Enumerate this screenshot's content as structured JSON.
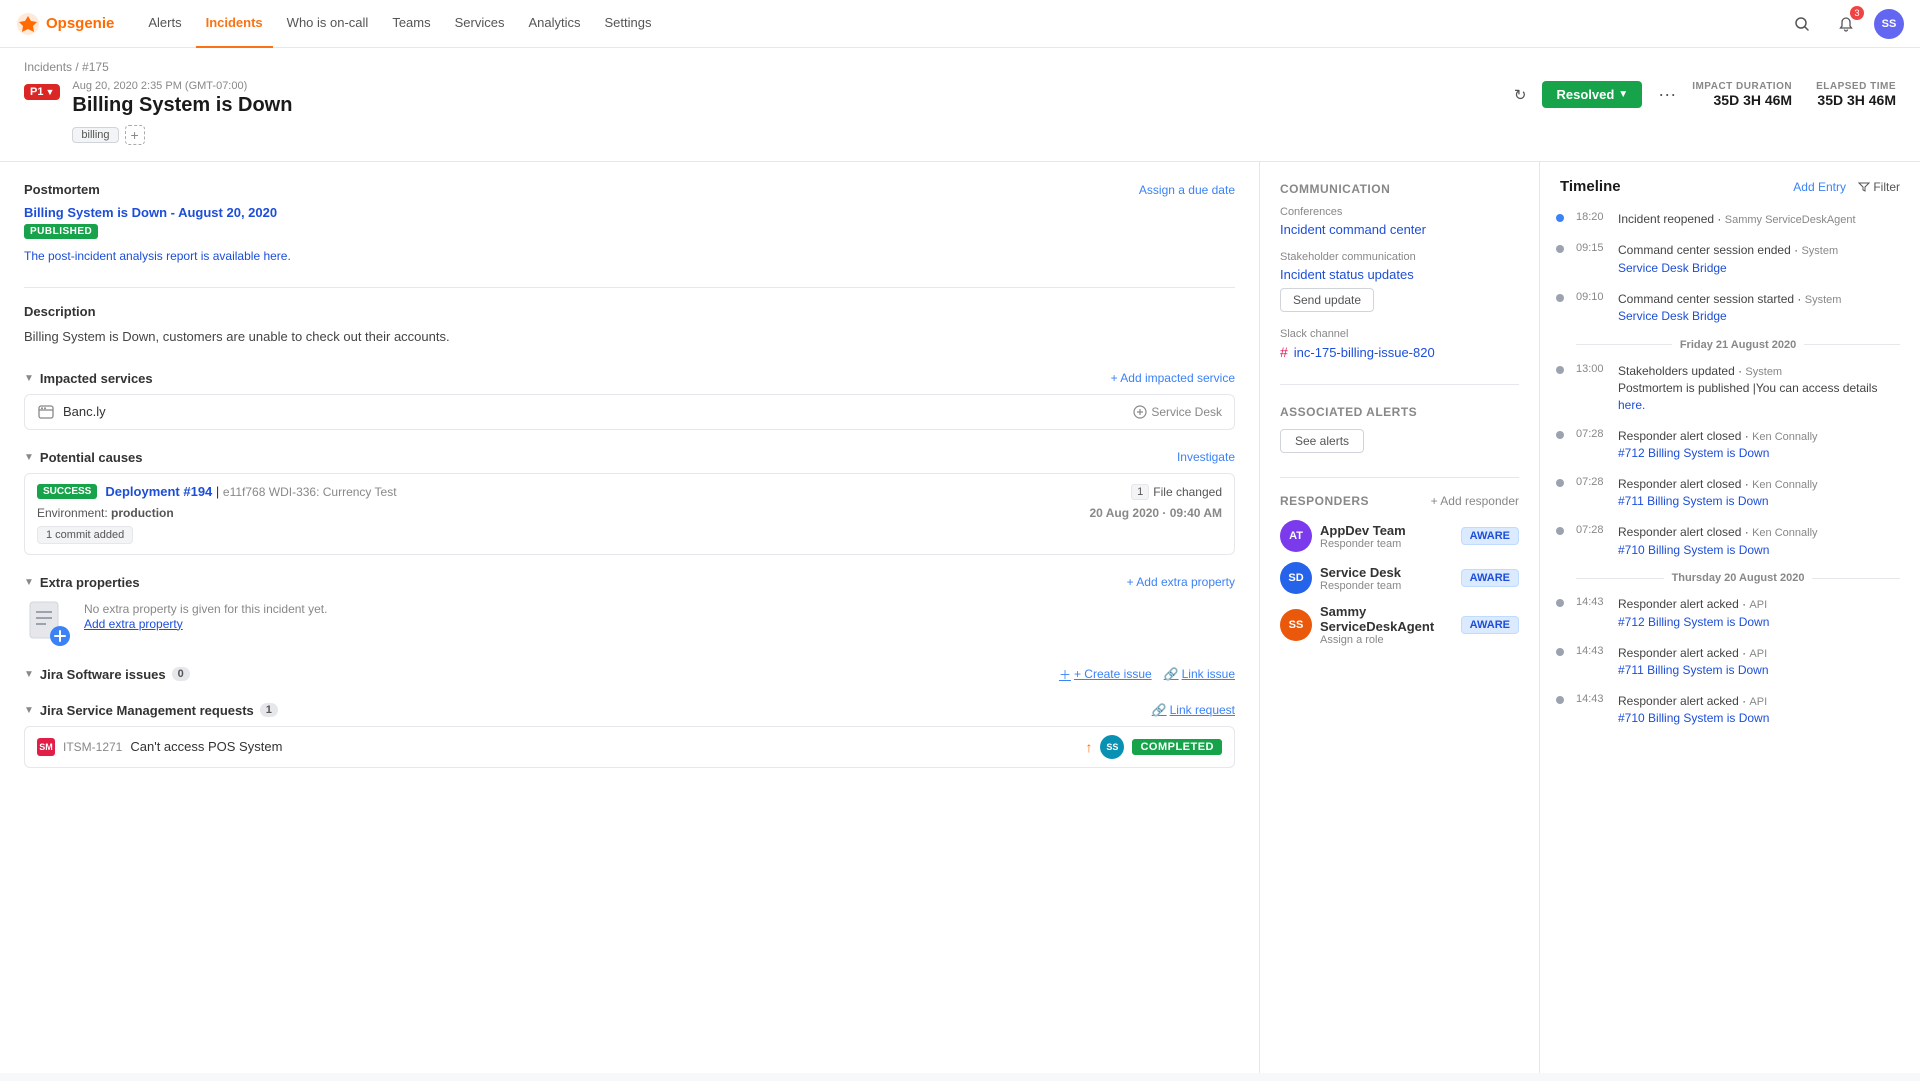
{
  "topnav": {
    "logo": "Opsgenie",
    "links": [
      "Alerts",
      "Incidents",
      "Who is on-call",
      "Teams",
      "Services",
      "Analytics",
      "Settings"
    ],
    "active_link": "Incidents",
    "notification_count": "3",
    "avatar_initials": "SS"
  },
  "header": {
    "breadcrumb_incidents": "Incidents",
    "breadcrumb_separator": "/",
    "breadcrumb_id": "#175",
    "date": "Aug 20, 2020 2:35 PM (GMT-07:00)",
    "title": "Billing System is Down",
    "priority": "P1",
    "tags": [
      "billing"
    ],
    "add_tag_label": "+",
    "resolve_label": "Resolved",
    "more_label": "···",
    "impact_duration_label": "IMPACT DURATION",
    "impact_duration_value": "35D 3H 46M",
    "elapsed_time_label": "ELAPSED TIME",
    "elapsed_time_value": "35D 3H 46M"
  },
  "postmortem": {
    "section_label": "Postmortem",
    "assign_due_date": "Assign a due date",
    "link_text": "Billing System is Down - August 20, 2020",
    "status": "PUBLISHED",
    "subtext": "The post-incident analysis report is available here."
  },
  "description": {
    "label": "Description",
    "text": "Billing System is Down, customers are unable to check out their accounts."
  },
  "impacted_services": {
    "label": "Impacted services",
    "add_label": "+ Add impacted service",
    "items": [
      {
        "name": "Banc.ly",
        "type": "Service Desk"
      }
    ]
  },
  "potential_causes": {
    "label": "Potential causes",
    "investigate_label": "Investigate",
    "items": [
      {
        "status": "SUCCESS",
        "deploy_label": "Deployment #194",
        "commit": "e11f768 WDI-336: Currency Test",
        "file_count": "1",
        "file_label": "File changed",
        "date": "20 Aug 2020 · 09:40 AM",
        "environment": "production",
        "commit_added": "1 commit added"
      }
    ]
  },
  "extra_properties": {
    "label": "Extra properties",
    "add_label": "+ Add extra property",
    "empty_text": "No extra property is given for this incident yet.",
    "add_link_label": "Add extra property"
  },
  "jira_issues": {
    "label": "Jira Software issues",
    "count": "0",
    "create_label": "+ Create issue",
    "link_label": "Link issue"
  },
  "jira_requests": {
    "label": "Jira Service Management requests",
    "count": "1",
    "link_label": "Link request",
    "items": [
      {
        "id": "ITSM-1271",
        "title": "Can't access POS System",
        "priority": "↑",
        "status": "COMPLETED"
      }
    ]
  },
  "communication": {
    "section_label": "COMMUNICATION",
    "conferences_label": "Conferences",
    "conferences_link": "Incident command center",
    "stakeholder_label": "Stakeholder communication",
    "stakeholder_link": "Incident status updates",
    "send_update_label": "Send update",
    "slack_label": "Slack channel",
    "slack_channel": "inc-175-billing-issue-820"
  },
  "associated_alerts": {
    "label": "ASSOCIATED ALERTS",
    "see_alerts_label": "See alerts"
  },
  "responders": {
    "section_label": "RESPONDERS",
    "add_label": "+ Add responder",
    "items": [
      {
        "name": "AppDev Team",
        "role": "Responder team",
        "status": "AWARE",
        "initials": "AT",
        "color": "av-purple"
      },
      {
        "name": "Service Desk",
        "role": "Responder team",
        "status": "AWARE",
        "initials": "SD",
        "color": "av-blue"
      },
      {
        "name": "Sammy ServiceDeskAgent",
        "role": "Assign a role",
        "status": "AWARE",
        "initials": "SS",
        "color": "av-orange"
      }
    ]
  },
  "timeline": {
    "title": "Timeline",
    "add_entry_label": "Add Entry",
    "filter_label": "Filter",
    "items": [
      {
        "time": "18:20",
        "text": "Incident reopened",
        "actor": "Sammy ServiceDeskAgent",
        "link": null
      },
      {
        "time": "09:15",
        "text": "Command center session ended",
        "actor": "System",
        "link": "Service Desk Bridge"
      },
      {
        "time": "09:10",
        "text": "Command center session started",
        "actor": "System",
        "link": "Service Desk Bridge"
      },
      {
        "date_divider": "Friday 21 August 2020"
      },
      {
        "time": "13:00",
        "text": "Stakeholders updated",
        "actor": "System",
        "multiline": "Postmortem is published |You can access details",
        "link": "here."
      },
      {
        "time": "07:28",
        "text": "Responder alert closed",
        "actor": "Ken Connally",
        "link": "#712 Billing System is Down"
      },
      {
        "time": "07:28",
        "text": "Responder alert closed",
        "actor": "Ken Connally",
        "link": "#711 Billing System is Down"
      },
      {
        "time": "07:28",
        "text": "Responder alert closed",
        "actor": "Ken Connally",
        "link": "#710 Billing System is Down"
      },
      {
        "date_divider": "Thursday 20 August 2020"
      },
      {
        "time": "14:43",
        "text": "Responder alert acked",
        "actor": "API",
        "link": "#712 Billing System is Down"
      },
      {
        "time": "14:43",
        "text": "Responder alert acked",
        "actor": "API",
        "link": "#711 Billing System is Down"
      },
      {
        "time": "14:43",
        "text": "Responder alert acked",
        "actor": "API",
        "link": "#710 Billing System is Down"
      }
    ]
  }
}
